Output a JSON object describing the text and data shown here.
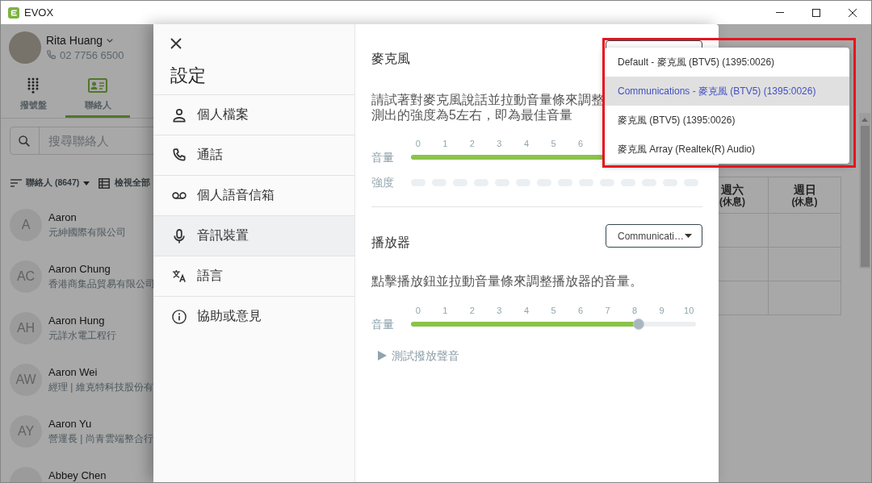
{
  "window": {
    "title": "EVOX"
  },
  "account": {
    "name": "Rita Huang",
    "phone": "02 7756 6500"
  },
  "nav_tabs": [
    {
      "kind": "dialpad",
      "label": "撥號盤",
      "selected": false
    },
    {
      "kind": "contacts",
      "label": "聯絡人",
      "selected": true
    }
  ],
  "contact_search": {
    "placeholder": "搜尋聯絡人"
  },
  "contact_filter": {
    "label": "聯絡人 (8647)",
    "view_all": "檢視全部"
  },
  "contacts": [
    {
      "initials": "A",
      "name": "Aaron",
      "detail": "元紳國際有限公司"
    },
    {
      "initials": "AC",
      "name": "Aaron Chung",
      "detail": "香港商集品貿易有限公司"
    },
    {
      "initials": "AH",
      "name": "Aaron Hung",
      "detail": "元詳水電工程行"
    },
    {
      "initials": "AW",
      "name": "Aaron Wei",
      "detail": "經理 | 維克特科技股份有"
    },
    {
      "initials": "AY",
      "name": "Aaron Yu",
      "detail": "營運長 | 尚青雲端整合行"
    },
    {
      "name": "Abbey Chen"
    }
  ],
  "schedule": {
    "columns": [
      {
        "day": "週六",
        "note": "(休息)"
      },
      {
        "day": "週日",
        "note": "(休息)"
      }
    ]
  },
  "settings": {
    "title": "設定",
    "menu": [
      {
        "kind": "profile",
        "label": "個人檔案",
        "selected": false
      },
      {
        "kind": "call",
        "label": "通話",
        "selected": false
      },
      {
        "kind": "voicemail",
        "label": "個人語音信箱",
        "selected": false
      },
      {
        "kind": "audio",
        "label": "音訊裝置",
        "selected": true
      },
      {
        "kind": "language",
        "label": "語言",
        "selected": false
      },
      {
        "kind": "help",
        "label": "協助或意見",
        "selected": false
      }
    ]
  },
  "audio": {
    "microphone": {
      "label": "麥克風",
      "menu_open": true,
      "highlighted": true,
      "options": [
        {
          "label": "Default - 麥克風 (BTV5) (1395:0026)",
          "selected": false
        },
        {
          "label": "Communications - 麥克風 (BTV5) (1395:0026)",
          "selected": true
        },
        {
          "label": "麥克風 (BTV5) (1395:0026)",
          "selected": false
        },
        {
          "label": "麥克風 Array (Realtek(R) Audio)",
          "selected": false
        }
      ],
      "hint_lines": [
        "請試著對麥克風說話並拉動音量條來調整",
        "測出的強度為5左右，即為最佳音量"
      ],
      "volume": {
        "label": "音量",
        "ticks": [
          "0",
          "1",
          "2",
          "3",
          "4",
          "5",
          "6"
        ],
        "level": 0.8
      },
      "strength": {
        "label": "強度"
      }
    },
    "speaker": {
      "label": "播放器",
      "value": "Communicati…",
      "hint": "點擊播放鈕並拉動音量條來調整播放器的音量。",
      "volume": {
        "label": "音量",
        "ticks": [
          "0",
          "1",
          "2",
          "3",
          "4",
          "5",
          "6",
          "7",
          "8",
          "9",
          "10"
        ],
        "level": 0.8
      },
      "test_button": "測試撥放聲音"
    }
  }
}
